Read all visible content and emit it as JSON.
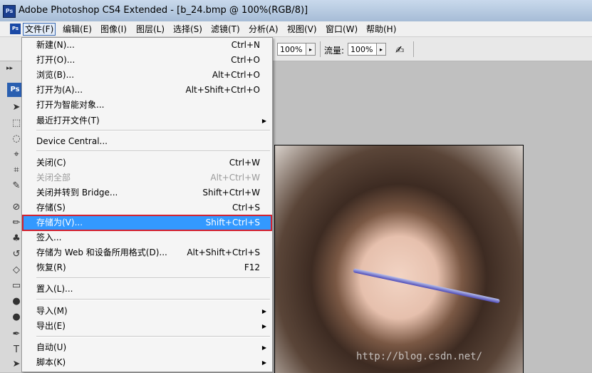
{
  "window": {
    "app_icon": "Ps",
    "title": "Adobe Photoshop CS4 Extended - [b_24.bmp @ 100%(RGB/8)]"
  },
  "menubar": {
    "logo": "Ps",
    "items": [
      "文件(F)",
      "编辑(E)",
      "图像(I)",
      "图层(L)",
      "选择(S)",
      "滤镜(T)",
      "分析(A)",
      "视图(V)",
      "窗口(W)",
      "帮助(H)"
    ]
  },
  "options": {
    "opacity_value": "100%",
    "flow_label": "流量:",
    "flow_value": "100%",
    "arrow": "▸"
  },
  "tools": {
    "dock_arrows": "▸▸",
    "ps_button": "Ps"
  },
  "file_menu": {
    "items": [
      {
        "label": "新建(N)...",
        "shortcut": "Ctrl+N"
      },
      {
        "label": "打开(O)...",
        "shortcut": "Ctrl+O"
      },
      {
        "label": "浏览(B)...",
        "shortcut": "Alt+Ctrl+O"
      },
      {
        "label": "打开为(A)...",
        "shortcut": "Alt+Shift+Ctrl+O"
      },
      {
        "label": "打开为智能对象...",
        "shortcut": ""
      },
      {
        "label": "最近打开文件(T)",
        "shortcut": "",
        "submenu": "▶"
      },
      {
        "label": "Device Central...",
        "shortcut": ""
      },
      {
        "label": "关闭(C)",
        "shortcut": "Ctrl+W"
      },
      {
        "label": "关闭全部",
        "shortcut": "Alt+Ctrl+W"
      },
      {
        "label": "关闭并转到 Bridge...",
        "shortcut": "Shift+Ctrl+W"
      },
      {
        "label": "存储(S)",
        "shortcut": "Ctrl+S"
      },
      {
        "label": "存储为(V)...",
        "shortcut": "Shift+Ctrl+S"
      },
      {
        "label": "签入...",
        "shortcut": ""
      },
      {
        "label": "存储为 Web 和设备所用格式(D)...",
        "shortcut": "Alt+Shift+Ctrl+S"
      },
      {
        "label": "恢复(R)",
        "shortcut": "F12"
      },
      {
        "label": "置入(L)...",
        "shortcut": ""
      },
      {
        "label": "导入(M)",
        "shortcut": "",
        "submenu": "▶"
      },
      {
        "label": "导出(E)",
        "shortcut": "",
        "submenu": "▶"
      },
      {
        "label": "自动(U)",
        "shortcut": "",
        "submenu": "▶"
      },
      {
        "label": "脚本(K)",
        "shortcut": "",
        "submenu": "▶"
      }
    ]
  },
  "watermark": "http://blog.csdn.net/"
}
